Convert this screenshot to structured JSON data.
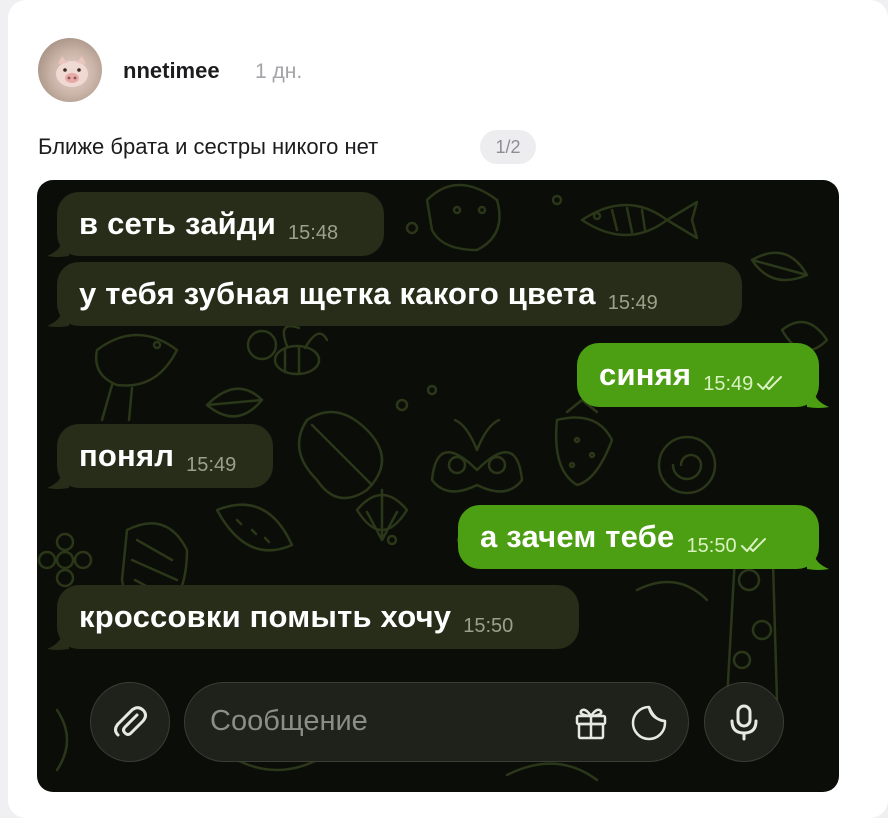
{
  "post": {
    "author": "nnetimee",
    "time_ago": "1 дн.",
    "text": "Ближе брата и сестры никого нет",
    "image_counter": "1/2"
  },
  "chat": {
    "messages": [
      {
        "direction": "in",
        "text": "в сеть зайди",
        "time": "15:48"
      },
      {
        "direction": "in",
        "text": "у тебя зубная щетка какого цвета",
        "time": "15:49"
      },
      {
        "direction": "out",
        "text": "синяя",
        "time": "15:49",
        "status": "read"
      },
      {
        "direction": "in",
        "text": "понял",
        "time": "15:49"
      },
      {
        "direction": "out",
        "text": "а зачем тебе",
        "time": "15:50",
        "status": "read"
      },
      {
        "direction": "in",
        "text": "кроссовки помыть хочу",
        "time": "15:50"
      }
    ],
    "composer": {
      "placeholder": "Сообщение",
      "attach_icon": "paperclip-icon",
      "gift_icon": "gift-icon",
      "sticker_icon": "sticker-icon",
      "mic_icon": "microphone-icon"
    },
    "colors": {
      "incoming_bubble": "#272d19",
      "outgoing_bubble": "#4c9e12",
      "background": "#0b0d08"
    }
  }
}
